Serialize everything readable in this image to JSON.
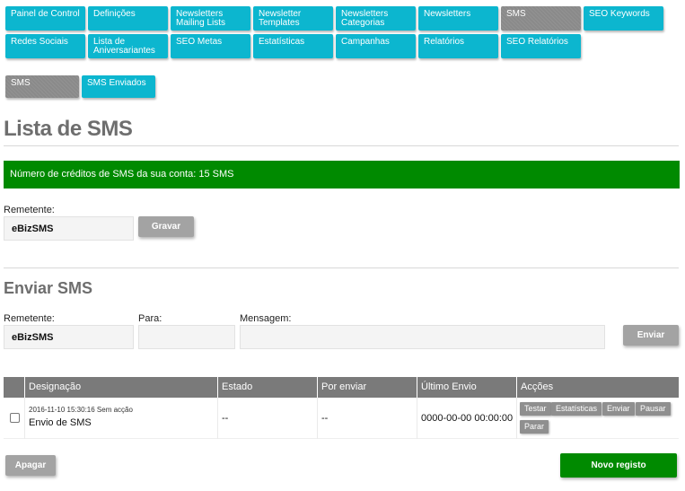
{
  "nav": {
    "row1": [
      {
        "label": "Painel de Control"
      },
      {
        "label": "Definições"
      },
      {
        "label": "Newsletters Mailing Lists"
      },
      {
        "label": "Newsletter Templates"
      },
      {
        "label": "Newsletters Categorias"
      },
      {
        "label": "Newsletters"
      },
      {
        "label": "SMS"
      },
      {
        "label": "SEO Keywords"
      }
    ],
    "row2": [
      {
        "label": "Redes Sociais"
      },
      {
        "label": "Lista de Aniversariantes"
      },
      {
        "label": "SEO Metas"
      },
      {
        "label": "Estatísticas"
      },
      {
        "label": "Campanhas"
      },
      {
        "label": "Relatórios"
      },
      {
        "label": "SEO Relatórios"
      }
    ]
  },
  "subnav": [
    {
      "label": "SMS"
    },
    {
      "label": "SMS Enviados"
    }
  ],
  "page_title": "Lista de SMS",
  "credits_text": "Número de créditos de SMS da sua conta: 15 SMS",
  "sender_form": {
    "label": "Remetente:",
    "value": "eBizSMS",
    "save_label": "Gravar"
  },
  "send_section": {
    "title": "Enviar SMS",
    "sender_label": "Remetente:",
    "sender_value": "eBizSMS",
    "to_label": "Para:",
    "to_value": "",
    "message_label": "Mensagem:",
    "message_value": "",
    "send_label": "Enviar"
  },
  "table": {
    "headers": [
      "Designação",
      "Estado",
      "Por enviar",
      "Último Envio",
      "Acções"
    ],
    "rows": [
      {
        "meta": "2016-11-10 15:30:16 Sem acção",
        "name": "Envio de SMS",
        "status": "--",
        "pending": "--",
        "last_sent": "0000-00-00 00:00:00",
        "actions": [
          "Testar",
          "Estatísticas",
          "Enviar",
          "Pausar",
          "Parar"
        ]
      }
    ]
  },
  "footer": {
    "delete_label": "Apagar",
    "new_label": "Novo registo"
  },
  "colors": {
    "nav_button": "#0cb6cf",
    "nav_active": "#8a8a8a",
    "success": "#008a00",
    "neutral_button": "#a3a3a3"
  }
}
